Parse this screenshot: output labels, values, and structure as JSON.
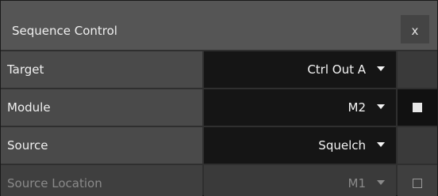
{
  "panel": {
    "title": "Sequence Control",
    "close_label": "x"
  },
  "rows": [
    {
      "label": "Target",
      "value": "Ctrl Out A",
      "extra": "none",
      "enabled": true
    },
    {
      "label": "Module",
      "value": "M2",
      "extra": "filled-square",
      "enabled": true
    },
    {
      "label": "Source",
      "value": "Squelch",
      "extra": "none",
      "enabled": true
    },
    {
      "label": "Source Location",
      "value": "M1",
      "extra": "outline-square",
      "enabled": false
    }
  ],
  "colors": {
    "titlebar": "#555555",
    "label_bg": "#4a4a4a",
    "select_bg": "#151515",
    "disabled_text": "#8a8a8a"
  }
}
